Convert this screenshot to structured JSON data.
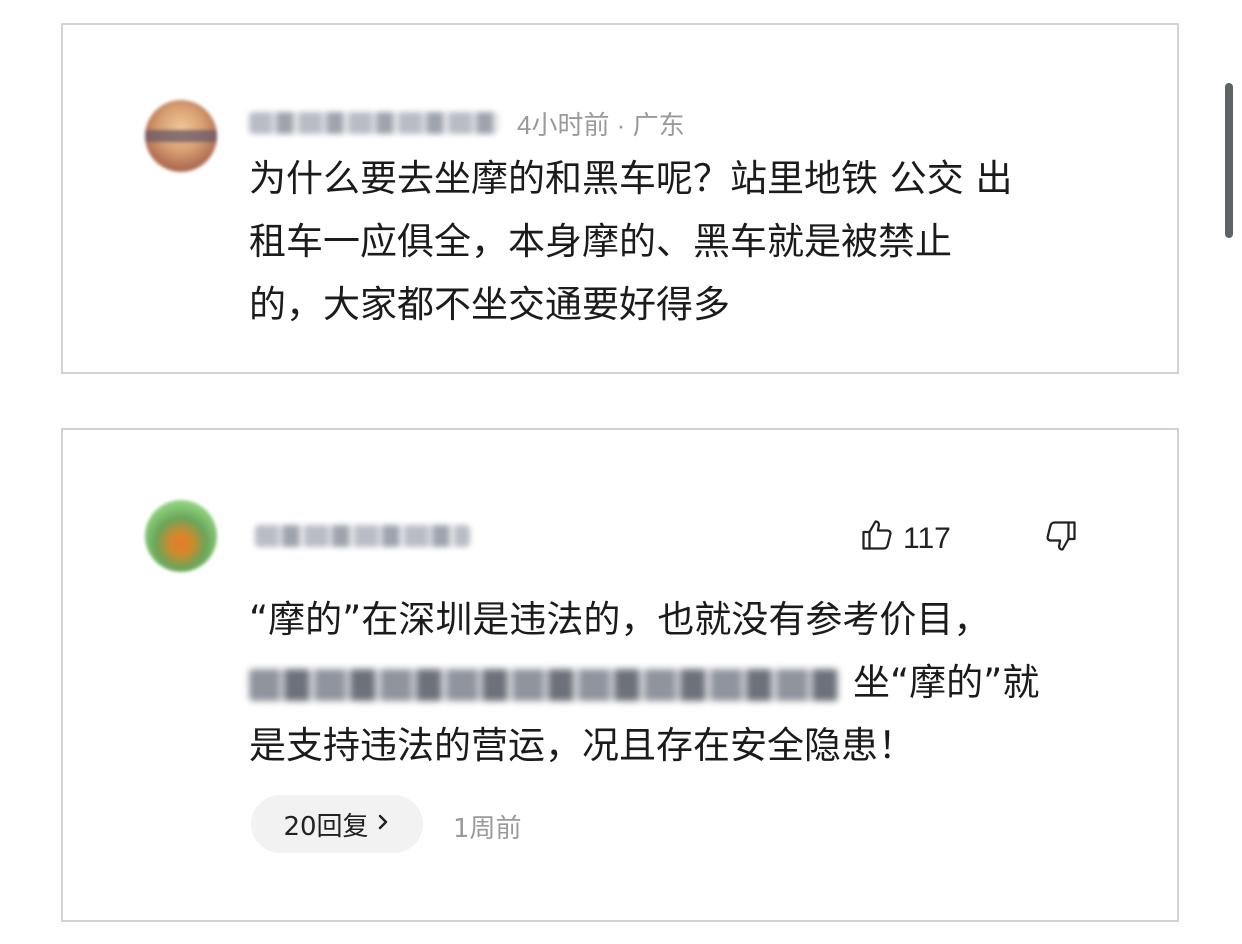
{
  "comment1": {
    "time_location": "4小时前 · 广东",
    "text_lines": [
      "为什么要去坐摩的和黑车呢？站里地铁 公交 出",
      "租车一应俱全，本身摩的、黑车就是被禁止",
      "的，大家都不坐交通要好得多"
    ]
  },
  "comment2": {
    "likes": "117",
    "text_line1": "“摩的”在深圳是违法的，也就没有参考价目，",
    "text_line2_visible": "坐“摩的”就",
    "text_line3": "是支持违法的营运，况且存在安全隐患！",
    "replies_label": "20回复",
    "time": "1周前"
  },
  "icons": {
    "like": "thumbs-up-icon",
    "dislike": "thumbs-down-icon",
    "reply_chevron": "chevron-right-icon"
  },
  "colors": {
    "card_border": "#cfd4da",
    "meta_text": "#9a9a9a",
    "pill_bg": "#f2f2f2",
    "scrollbar": "#5f6368"
  }
}
